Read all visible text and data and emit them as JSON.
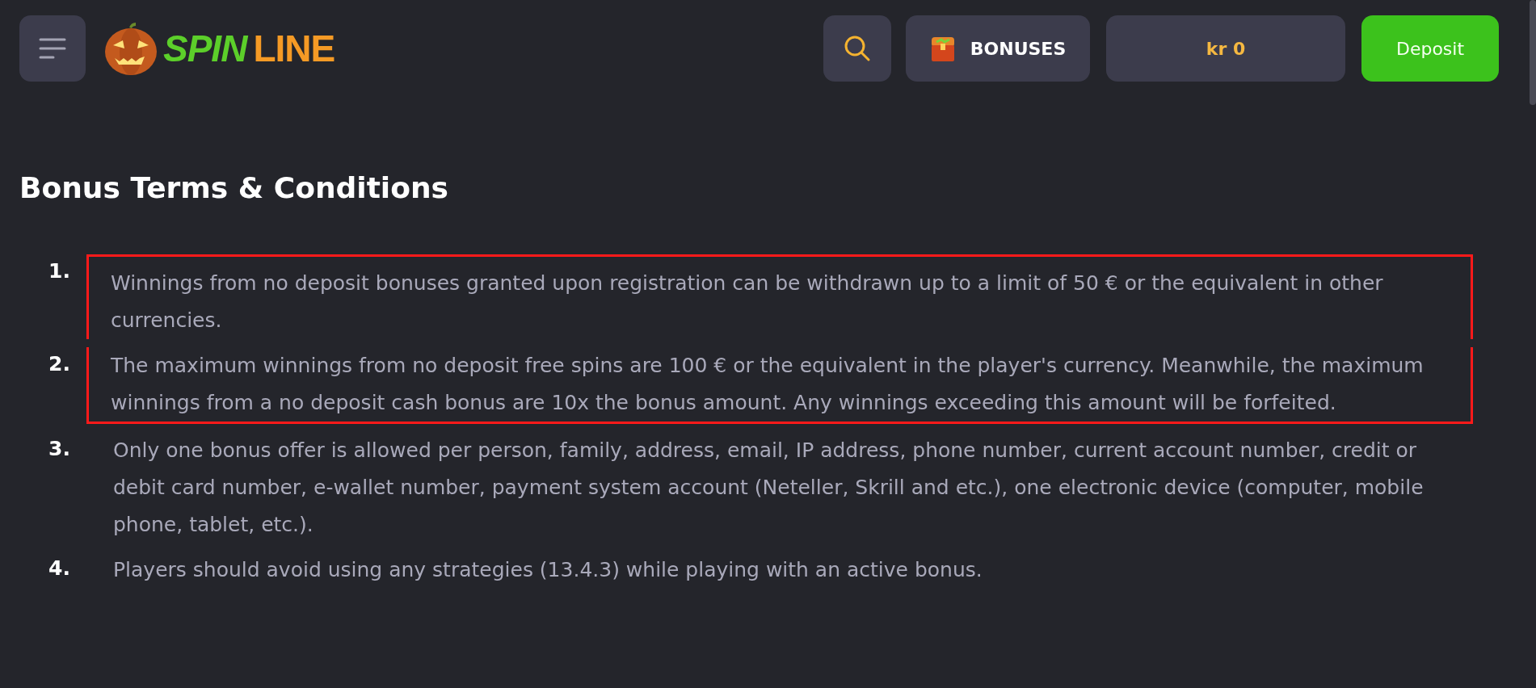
{
  "header": {
    "logo": {
      "word_1": "SPIN",
      "word_2": "LINE"
    },
    "bonuses_label": "BONUSES",
    "balance": "kr 0",
    "deposit_label": "Deposit"
  },
  "title": "Bonus Terms & Conditions",
  "terms": [
    {
      "number": "1.",
      "text": "Winnings from no deposit bonuses granted upon registration can be withdrawn up to a limit of 50 € or the equivalent in other currencies.",
      "highlighted": true
    },
    {
      "number": "2.",
      "text": "The maximum winnings from no deposit free spins are 100 € or the equivalent in the player's currency. Meanwhile, the maximum winnings from a no deposit cash bonus are 10x the bonus amount. Any winnings exceeding this amount will be forfeited.",
      "highlighted": true
    },
    {
      "number": "3.",
      "text": "Only one bonus offer is allowed per person, family, address, email, IP address, phone number, current account number, credit or debit card number, e-wallet number, payment system account (Neteller, Skrill and etc.), one electronic device (computer, mobile phone, tablet, etc.).",
      "highlighted": false
    },
    {
      "number": "4.",
      "text": "Players should avoid using any strategies (13.4.3) while playing with an active bonus.",
      "highlighted": false
    }
  ]
}
